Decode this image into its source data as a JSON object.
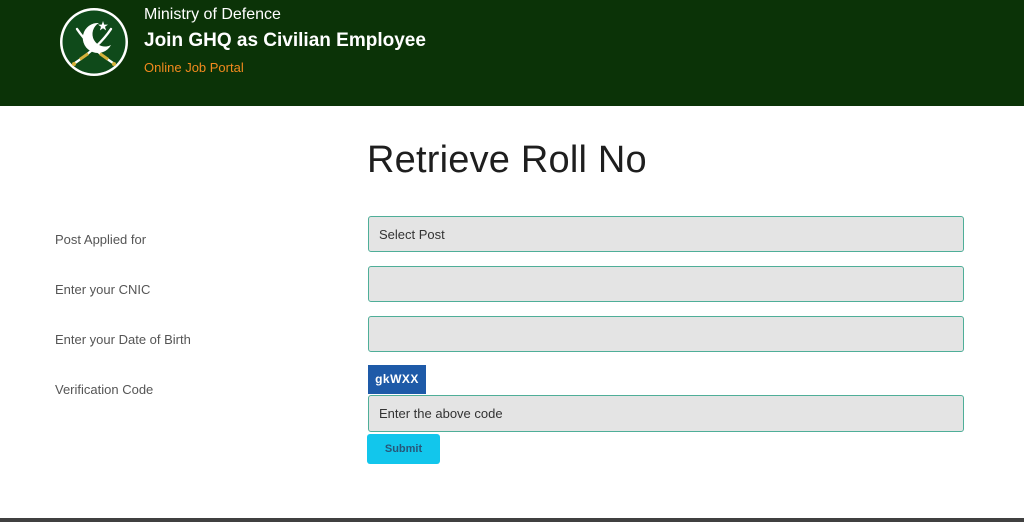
{
  "header": {
    "ministry": "Ministry of Defence",
    "brand": "Join GHQ as Civilian Employee",
    "subtitle": "Online Job Portal",
    "logo_icon": "crescent-star-crossed-swords-icon",
    "bg_color": "#0b3307",
    "subtitle_color": "#f28a1e"
  },
  "page": {
    "title": "Retrieve Roll No"
  },
  "form": {
    "post": {
      "label": "Post Applied for",
      "value": "Select Post"
    },
    "cnic": {
      "label": "Enter your CNIC",
      "value": ""
    },
    "dob": {
      "label": "Enter your Date of Birth",
      "value": ""
    },
    "verification": {
      "label": "Verification Code",
      "captcha_text": "gkWXX",
      "input_placeholder": "Enter the above code"
    },
    "submit_label": "Submit",
    "submit_color": "#12c6ec"
  }
}
